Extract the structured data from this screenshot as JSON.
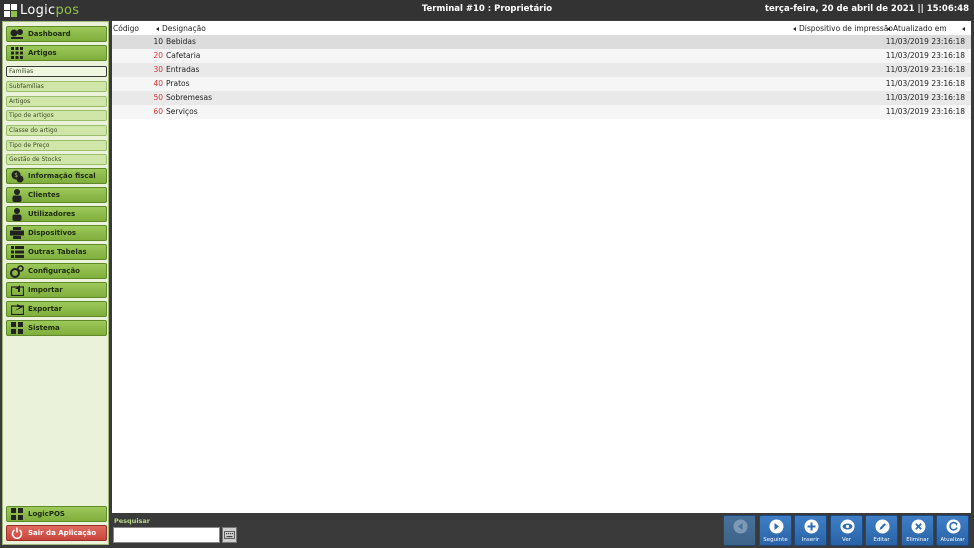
{
  "header": {
    "app_name_prefix": "Logic",
    "app_name_suffix": "pos",
    "title": "Terminal #10 : Proprietário",
    "datetime": "terça-feira, 20 de abril de 2021 || 15:06:48"
  },
  "sidebar": {
    "dashboard": "Dashboard",
    "artigos": "Artigos",
    "sub": [
      "Famílias",
      "Subfamílias",
      "Artigos",
      "Tipo de artigos",
      "Classe do artigo",
      "Tipo de Preço",
      "Gestão de Stocks"
    ],
    "informacao_fiscal": "Informação fiscal",
    "clientes": "Clientes",
    "utilizadores": "Utilizadores",
    "dispositivos": "Dispositivos",
    "outras_tabelas": "Outras Tabelas",
    "configuracao": "Configuração",
    "importar": "Importar",
    "exportar": "Exportar",
    "sistema": "Sistema",
    "logicpos": "LogicPOS",
    "sair": "Sair da Aplicação"
  },
  "grid": {
    "columns": {
      "codigo": "Código",
      "designacao": "Designação",
      "dispositivo": "Dispositivo de impressão",
      "atualizado": "Atualizado em"
    },
    "rows": [
      {
        "code": "10",
        "name": "Bebidas",
        "date": "11/03/2019 23:16:18"
      },
      {
        "code": "20",
        "name": "Cafetaria",
        "date": "11/03/2019 23:16:18"
      },
      {
        "code": "30",
        "name": "Entradas",
        "date": "11/03/2019 23:16:18"
      },
      {
        "code": "40",
        "name": "Pratos",
        "date": "11/03/2019 23:16:18"
      },
      {
        "code": "50",
        "name": "Sobremesas",
        "date": "11/03/2019 23:16:18"
      },
      {
        "code": "60",
        "name": "Serviços",
        "date": "11/03/2019 23:16:18"
      }
    ]
  },
  "bottom": {
    "search_label": "Pesquisar",
    "search_value": "",
    "actions": {
      "anterior": "",
      "seguinte": "Seguinte",
      "inserir": "Inserir",
      "ver": "Ver",
      "editar": "Editar",
      "eliminar": "Eliminar",
      "atualizar": "Atualizar"
    }
  },
  "colors": {
    "accent_green": "#8fc24a",
    "action_blue": "#2f6cb3",
    "exit_red": "#d4524a",
    "code_red": "#dd3333"
  }
}
